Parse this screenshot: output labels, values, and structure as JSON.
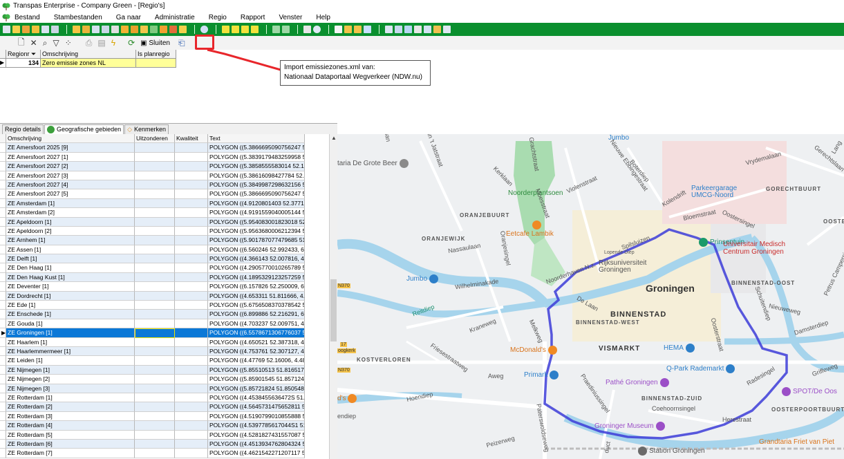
{
  "window": {
    "title": "Transpas Enterprise - Company Green - [Regio's]"
  },
  "menu": [
    "Bestand",
    "Stambestanden",
    "Ga naar",
    "Administratie",
    "Regio",
    "Rapport",
    "Venster",
    "Help"
  ],
  "toolbar2": {
    "close_label": "Sluiten"
  },
  "top_grid": {
    "headers": [
      "Regionr",
      "Omschrijving",
      "Is planregio"
    ],
    "row": {
      "regionr": "134",
      "omschrijving": "Zero emissie zones NL",
      "is_planregio": ""
    }
  },
  "callout": {
    "line1": "Import emissiezones.xml van:",
    "line2": "Nationaal Dataportaal Wegverkeer (NDW.nu)"
  },
  "tabs": [
    "Regio details",
    "Geografische gebieden",
    "Kenmerken"
  ],
  "zone_grid": {
    "headers": [
      "Omschrijving",
      "Uitzonderen",
      "Kwaliteit",
      "Text"
    ],
    "rows": [
      [
        "ZE Amersfoort 2025 [9]",
        "POLYGON ((5.3866695090756247 52"
      ],
      [
        "ZE Amersfoort 2027 [1]",
        "POLYGON ((5.3839179483259958 52"
      ],
      [
        "ZE Amersfoort 2027 [2]",
        "POLYGON ((5.3858555583014 52.155"
      ],
      [
        "ZE Amersfoort 2027 [3]",
        "POLYGON ((5.38616098427784 52.1"
      ],
      [
        "ZE Amersfoort 2027 [4]",
        "POLYGON ((5.3849987298632156 52"
      ],
      [
        "ZE Amersfoort 2027 [5]",
        "POLYGON ((5.3866695090756247 52"
      ],
      [
        "ZE Amsterdam [1]",
        "POLYGON ((4.9120801403 52.377183"
      ],
      [
        "ZE Amsterdam [2]",
        "POLYGON ((4.9191559040005144 52"
      ],
      [
        "ZE Apeldoorn [1]",
        "POLYGON ((5.954083001823018 52.2"
      ],
      [
        "ZE Apeldoorn [2]",
        "POLYGON ((5.9563680006212394 52"
      ],
      [
        "ZE Arnhem [1]",
        "POLYGON ((5.901787077479685 51.9"
      ],
      [
        "ZE Assen [1]",
        "POLYGON ((6.560246 52.992433, 6.5"
      ],
      [
        "ZE Delft [1]",
        "POLYGON ((4.366143 52.007816, 4.3"
      ],
      [
        "ZE Den Haag [1]",
        "POLYGON ((4.2905770010265789 52"
      ],
      [
        "ZE Den Haag Kust [1]",
        "POLYGON ((4.1895329123257259 52"
      ],
      [
        "ZE Deventer [1]",
        "POLYGON ((6.157826 52.250009, 6.1"
      ],
      [
        "ZE Dordrecht [1]",
        "POLYGON ((4.653311 51.811666, 4.6"
      ],
      [
        "ZE Ede [1]",
        "POLYGON ((5.6756508370378542 52"
      ],
      [
        "ZE Enschede [1]",
        "POLYGON ((6.899886 52.216291, 6.9"
      ],
      [
        "ZE Gouda [1]",
        "POLYGON ((4.703237 52.009751, 4.7"
      ],
      [
        "ZE Groningen [1]",
        "POLYGON ((6.5578671306776037 53"
      ],
      [
        "ZE Haarlem [1]",
        "POLYGON ((4.650521 52.387318, 4.6"
      ],
      [
        "ZE Haarlemmermeer [1]",
        "POLYGON ((4.753761 52.307127, 4.7"
      ],
      [
        "ZE Leiden [1]",
        "POLYGON ((4.47769 52.16006, 4.480"
      ],
      [
        "ZE Nijmegen [1]",
        "POLYGON ((5.85510513 51.81651752"
      ],
      [
        "ZE Nijmegen [2]",
        "POLYGON ((5.85901545 51.8571242"
      ],
      [
        "ZE Nijmegen [3]",
        "POLYGON ((5.85721824 51.8505486,"
      ],
      [
        "ZE Rotterdam [1]",
        "POLYGON ((4.4538455636472S 51.87"
      ],
      [
        "ZE Rotterdam [2]",
        "POLYGON ((4.5645731475652811 51"
      ],
      [
        "ZE Rotterdam [3]",
        "POLYGON ((4.5190799010855888 51.8"
      ],
      [
        "ZE Rotterdam [4]",
        "POLYGON ((4.5397785617044S1 51.8"
      ],
      [
        "ZE Rotterdam [5]",
        "POLYGON ((4.5281827431557087 51"
      ],
      [
        "ZE Rotterdam [6]",
        "POLYGON ((4.4513934762804324 51"
      ],
      [
        "ZE Rotterdam [7]",
        "POLYGON ((4.4621542271207117 51"
      ]
    ],
    "selected_index": 20
  },
  "map": {
    "city": "Groningen",
    "districts": [
      "BINNENSTAD",
      "BINNENSTAD-WEST",
      "BINNENSTAD-OOST",
      "BINNENSTAD-ZUID",
      "ORANJEBUURT",
      "ORANJEWIJK",
      "KOSTVERLOREN",
      "GORECHTBUURT",
      "OOSTERPA",
      "OOSTERPOORTBUURT"
    ],
    "pois": [
      "Jumbo",
      "taria De Grote Beer",
      "Noorderplantsoen",
      "Eetcafe Lambik",
      "Parkeergarage UMCG-Noord",
      "Prinsentuin",
      "Universitair Medisch Centrum Groningen",
      "Rijksuniversiteit Groningen",
      "Jumbo",
      "McDonald's",
      "VISMARKT",
      "HEMA",
      "Q-Park Rademarkt",
      "Pathé Groningen",
      "Primark",
      "Groninger Museum",
      "Station Groningen",
      "Grandtaria Friet van Piet",
      "SPOT/De Oos",
      "d's",
      "Herestraat"
    ],
    "streets": [
      "Noorderhaven N.z.",
      "Wilhelminakade",
      "Nassaulaan",
      "Oranjesingel",
      "Kraneweg",
      "Friesestraatweg",
      "Hoendiep",
      "Aweg",
      "Peizerweg",
      "Paterswoldseweg",
      "Praediniussingel",
      "Coehoornsingel",
      "Radesingel",
      "Schuitendiep",
      "Oosterstraat",
      "De Laan",
      "Melkweg",
      "Reitdiep",
      "Spilsluizen",
      "Boterdiep",
      "Nieuwe Ebbingestraat",
      "Violenstraat",
      "Kolendrift",
      "Bloemstraat",
      "Oostersingel",
      "Vrydemalaan",
      "Nieuweweg",
      "Damsterdiep",
      "Griffeweg",
      "Petrus Campersingel",
      "Lopende Diep",
      "endiep",
      "Gerechtslaan",
      "Lang",
      "Kerklaan",
      "Grachtstraat",
      "Kijk in 't Jatstraat",
      "Moesstraat",
      "duct",
      "lan",
      "N370",
      "17",
      "oogkerk"
    ]
  }
}
